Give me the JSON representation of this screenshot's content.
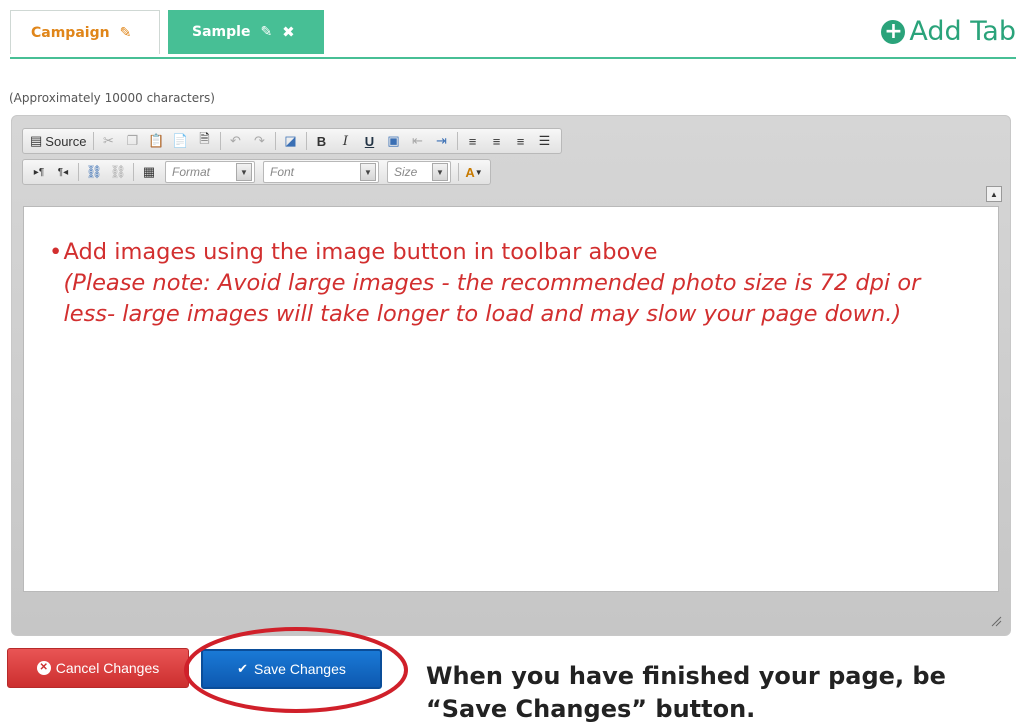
{
  "tabs": [
    {
      "label": "Campaign",
      "active": false
    },
    {
      "label": "Sample",
      "active": true
    }
  ],
  "add_tab_label": "Add Tab",
  "char_hint": "(Approximately 10000 characters)",
  "toolbar": {
    "source_label": "Source",
    "format_placeholder": "Format",
    "font_placeholder": "Font",
    "size_placeholder": "Size"
  },
  "content": {
    "bullet_text": "Add images using the image button in toolbar above",
    "note": "(Please note: Avoid large images - the recommended photo size is 72 dpi or less- large images will take longer to load and may slow your page down.)"
  },
  "buttons": {
    "cancel_label": "Cancel Changes",
    "save_label": "Save Changes"
  },
  "instruction": {
    "line1": "When you have finished your page, be",
    "line2": "“Save Changes” button."
  },
  "colors": {
    "tab_accent": "#47bf95",
    "content_text": "#d22f2f",
    "cancel": "#cc2f2f",
    "save": "#0d59b0",
    "highlight_ring": "#d0202a"
  }
}
